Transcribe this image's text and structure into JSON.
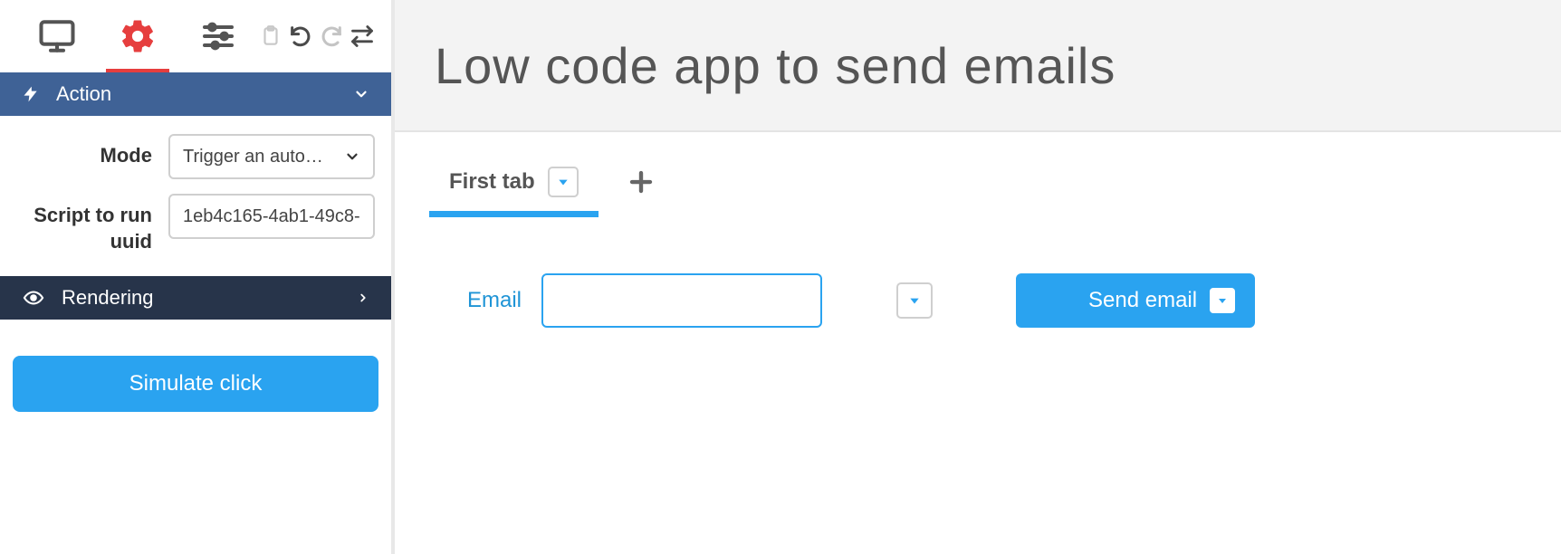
{
  "sidebar": {
    "sections": {
      "action": {
        "title": "Action",
        "mode_label": "Mode",
        "mode_value": "Trigger an automation",
        "script_label": "Script to run uuid",
        "script_value": "1eb4c165-4ab1-49c8-"
      },
      "rendering": {
        "title": "Rendering"
      }
    },
    "simulate_button": "Simulate click"
  },
  "header": {
    "title": "Low code app to send emails"
  },
  "tabs": {
    "first": "First tab"
  },
  "form": {
    "email_label": "Email",
    "email_value": "",
    "send_button": "Send email"
  },
  "colors": {
    "accent_blue": "#2aa3f0",
    "section_blue": "#3f6296",
    "section_dark": "#27344a",
    "accent_red": "#e63e3e"
  }
}
